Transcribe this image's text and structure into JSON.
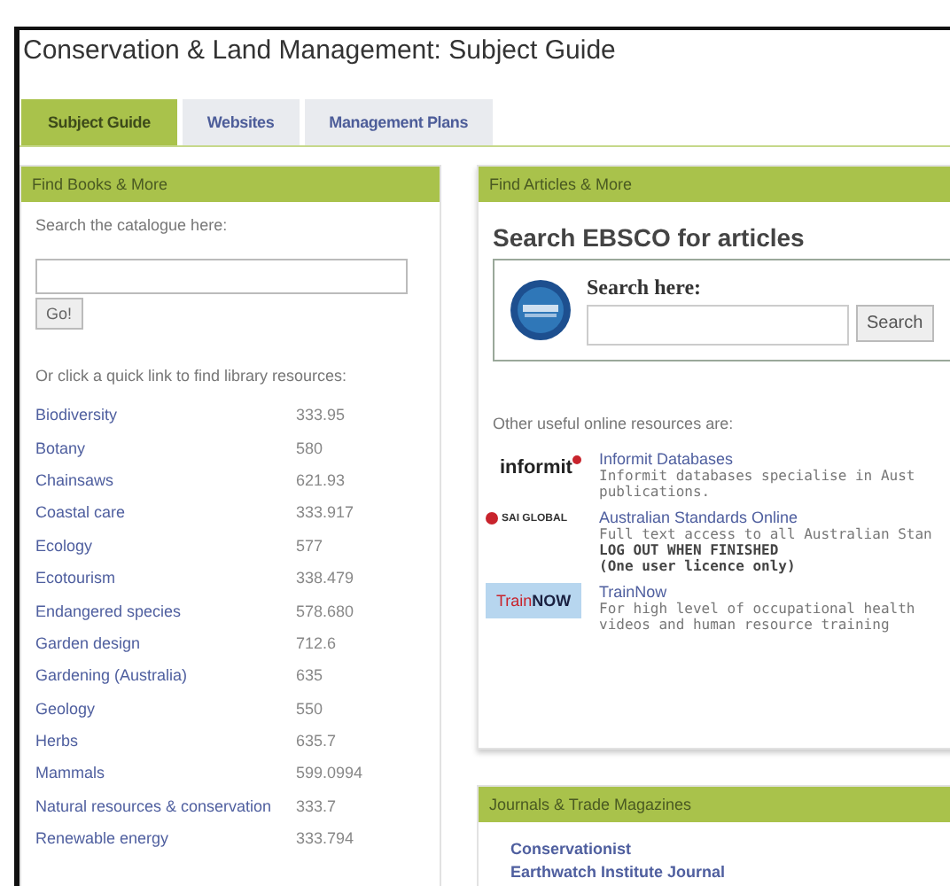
{
  "title": "Conservation & Land Management: Subject Guide",
  "tabs": [
    {
      "label": "Subject Guide",
      "selected": true
    },
    {
      "label": "Websites",
      "selected": false
    },
    {
      "label": "Management Plans",
      "selected": false
    }
  ],
  "books": {
    "header": "Find Books & More",
    "prompt": "Search the catalogue here:",
    "button": "Go!",
    "quick_intro": "Or click a quick link to find library resources:",
    "links": [
      {
        "subject": "Biodiversity",
        "call_number": "333.95"
      },
      {
        "subject": "Botany",
        "call_number": "580"
      },
      {
        "subject": "Chainsaws",
        "call_number": "621.93"
      },
      {
        "subject": "Coastal care",
        "call_number": "333.917"
      },
      {
        "subject": "Ecology",
        "call_number": "577"
      },
      {
        "subject": "Ecotourism",
        "call_number": "338.479"
      },
      {
        "subject": "Endangered species",
        "call_number": "578.680"
      },
      {
        "subject": "Garden design",
        "call_number": "712.6"
      },
      {
        "subject": "Gardening (Australia)",
        "call_number": "635"
      },
      {
        "subject": "Geology",
        "call_number": "550"
      },
      {
        "subject": "Herbs",
        "call_number": "635.7"
      },
      {
        "subject": "Mammals",
        "call_number": "599.0994"
      },
      {
        "subject": "Natural resources & conservation",
        "call_number": "333.7"
      },
      {
        "subject": "Renewable energy",
        "call_number": "333.794"
      }
    ]
  },
  "articles": {
    "header": "Find Articles & More",
    "heading": "Search EBSCO for articles",
    "search_label": "Search here:",
    "search_button": "Search",
    "resources_intro": "Other useful online resources are:",
    "resources": [
      {
        "kind": "informit",
        "logo": "informit",
        "title": "Informit Databases",
        "lines": [
          {
            "text": "Informit databases specialise in Aust",
            "bold": false
          },
          {
            "text": "publications.",
            "bold": false
          }
        ]
      },
      {
        "kind": "saiglobal",
        "logo": "SAI GLOBAL",
        "title": "Australian Standards Online",
        "lines": [
          {
            "text": "Full text access to all Australian Stan",
            "bold": false
          },
          {
            "text": "LOG OUT WHEN FINISHED",
            "bold": true
          },
          {
            "text": "(One user licence only)",
            "bold": true
          }
        ]
      },
      {
        "kind": "trainnow",
        "logo": [
          "Train",
          "NOW"
        ],
        "title": "TrainNow",
        "lines": [
          {
            "text": "For high level of occupational health",
            "bold": false
          },
          {
            "text": "videos and human resource training",
            "bold": false
          }
        ]
      }
    ]
  },
  "journals": {
    "header": "Journals & Trade Magazines",
    "links": [
      "Conservationist",
      "Earthwatch Institute Journal"
    ]
  }
}
